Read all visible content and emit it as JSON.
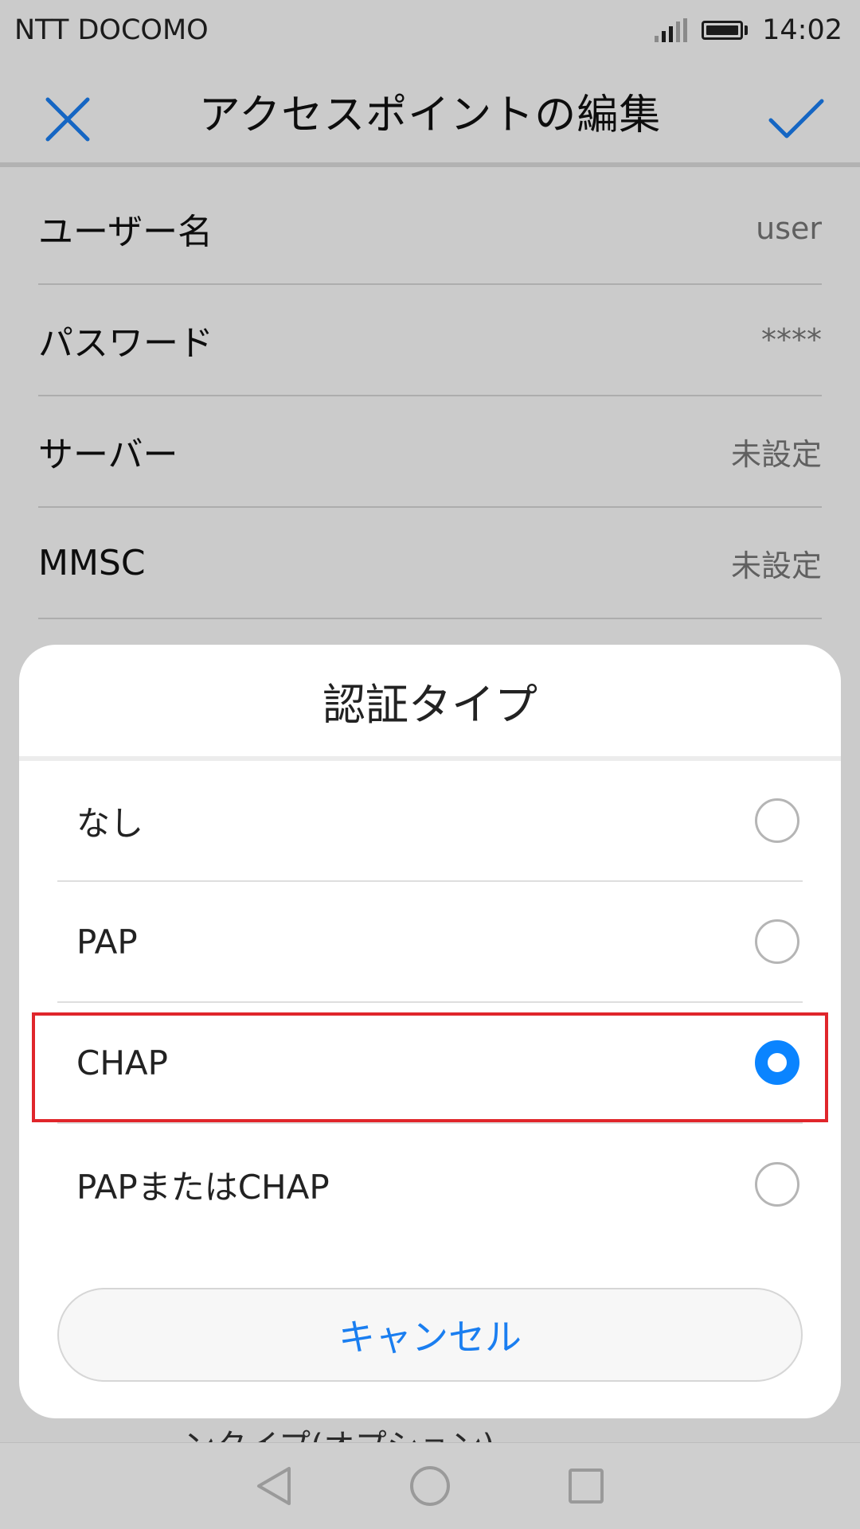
{
  "status_bar": {
    "carrier": "NTT DOCOMO",
    "time": "14:02",
    "icons": [
      "signal-icon",
      "battery-icon"
    ]
  },
  "toolbar": {
    "title": "アクセスポイントの編集",
    "close_icon": "close-icon",
    "confirm_icon": "checkmark-icon"
  },
  "fields": [
    {
      "label": "ユーザー名",
      "value": "user"
    },
    {
      "label": "パスワード",
      "value": "****"
    },
    {
      "label": "サーバー",
      "value": "未設定"
    },
    {
      "label": "MMSC",
      "value": "未設定"
    }
  ],
  "dialog": {
    "title": "認証タイプ",
    "options": [
      {
        "label": "なし",
        "selected": false
      },
      {
        "label": "PAP",
        "selected": false
      },
      {
        "label": "CHAP",
        "selected": true
      },
      {
        "label": "PAPまたはCHAP",
        "selected": false
      }
    ],
    "cancel_label": "キャンセル"
  },
  "behind_text": "ンタイプ(オプション)",
  "nav_bar": {
    "icons": [
      "back-icon",
      "home-icon",
      "recents-icon"
    ]
  },
  "colors": {
    "accent": "#0a84ff",
    "cancel_text": "#1a7ef0",
    "highlight_box": "#e0262b"
  }
}
